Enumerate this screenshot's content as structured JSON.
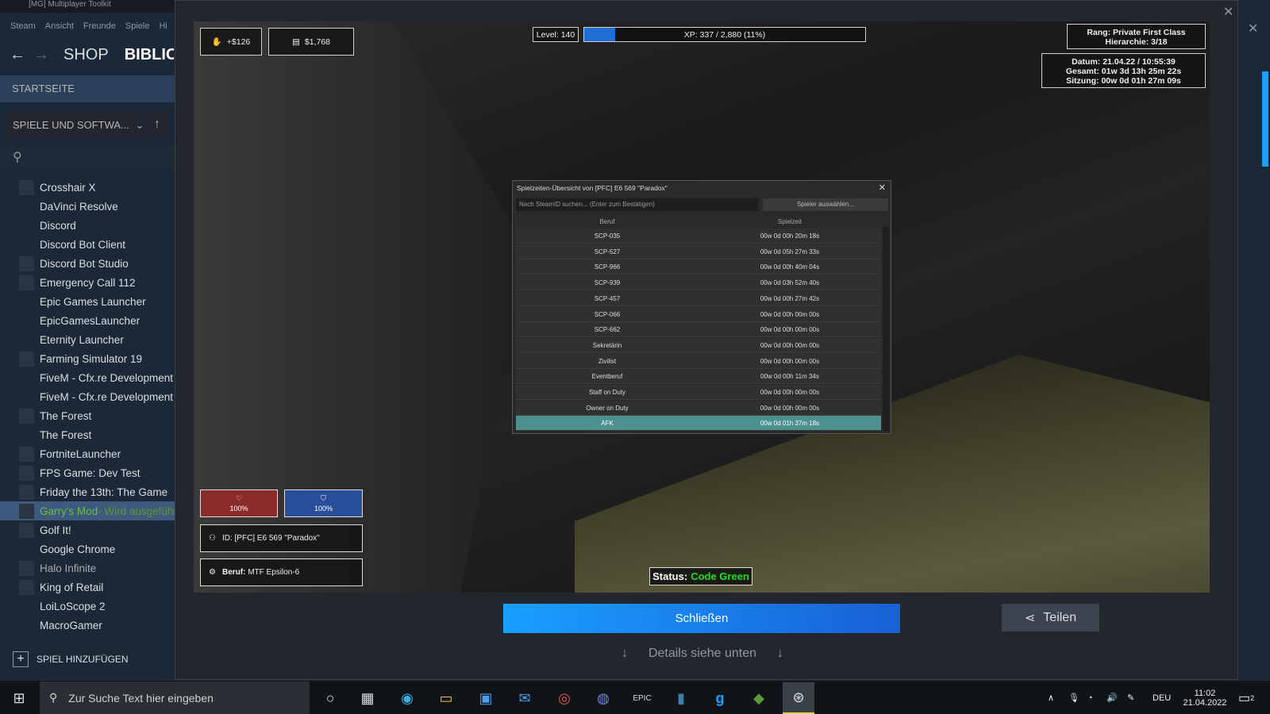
{
  "steam": {
    "window_title": "[MG] Multiplayer Toolkit",
    "menu": [
      "Steam",
      "Ansicht",
      "Freunde",
      "Spiele",
      "Hilfe"
    ],
    "nav": {
      "shop": "SHOP",
      "library": "BIBLIOTHEK"
    },
    "home": "STARTSEITE",
    "filter": "SPIELE UND SOFTWA...",
    "add_game": "SPIEL HINZUFÜGEN",
    "games": [
      {
        "name": "Crosshair X",
        "icon": "crosshair-icon"
      },
      {
        "name": "DaVinci Resolve",
        "icon": "blank-icon"
      },
      {
        "name": "Discord",
        "icon": "blank-icon"
      },
      {
        "name": "Discord Bot Client",
        "icon": "blank-icon"
      },
      {
        "name": "Discord Bot Studio",
        "icon": "gear-icon"
      },
      {
        "name": "Emergency Call 112",
        "icon": "game-icon"
      },
      {
        "name": "Epic Games Launcher",
        "icon": "blank-icon"
      },
      {
        "name": "EpicGamesLauncher",
        "icon": "blank-icon"
      },
      {
        "name": "Eternity Launcher",
        "icon": "blank-icon"
      },
      {
        "name": "Farming Simulator 19",
        "icon": "game-icon"
      },
      {
        "name": "FiveM - Cfx.re Development",
        "icon": "blank-icon"
      },
      {
        "name": "FiveM - Cfx.re Development",
        "icon": "blank-icon"
      },
      {
        "name": "The Forest",
        "icon": "game-icon"
      },
      {
        "name": "The Forest",
        "icon": "blank-icon"
      },
      {
        "name": "FortniteLauncher",
        "icon": "game-icon"
      },
      {
        "name": "FPS Game: Dev Test",
        "icon": "game-icon"
      },
      {
        "name": "Friday the 13th: The Game",
        "icon": "game-icon"
      },
      {
        "name": "Garry's Mod",
        "icon": "game-icon",
        "status": " - Wird ausgeführt"
      },
      {
        "name": "Golf It!",
        "icon": "game-icon"
      },
      {
        "name": "Google Chrome",
        "icon": "blank-icon"
      },
      {
        "name": "Halo Infinite",
        "icon": "game-icon"
      },
      {
        "name": "King of Retail",
        "icon": "game-icon"
      },
      {
        "name": "LoiLoScope 2",
        "icon": "blank-icon"
      },
      {
        "name": "MacroGamer",
        "icon": "blank-icon"
      }
    ]
  },
  "hud": {
    "money_delta": "+$126",
    "money_total": "$1,768",
    "level": "Level: 140",
    "xp": "XP: 337 / 2,880 (11%)",
    "xp_fraction": 0.11,
    "rank": "Rang: Private First Class",
    "hierarchy": "Hierarchie: 3/18",
    "date": "Datum: 21.04.22 / 10:55:39",
    "total": "Gesamt: 01w 3d 13h 25m 22s",
    "session": "Sitzung: 00w 0d 01h 27m 09s",
    "health": "100%",
    "armor": "100%",
    "id": "ID: [PFC] E6 569 \"Paradox\"",
    "job_label": "Beruf:",
    "job": "MTF Epsilon-6",
    "status_label": "Status:",
    "status_value": "Code Green"
  },
  "dialog": {
    "title": "Spielzeiten-Übersicht von [PFC] E6 569 \"Paradox\"",
    "search_placeholder": "Nach SteamID suchen... (Enter zum Bestätigen)",
    "select_button": "Spieler auswählen...",
    "col_job": "Beruf",
    "col_time": "Spielzeit",
    "rows": [
      {
        "job": "SCP-035",
        "time": "00w 0d 00h 20m 18s"
      },
      {
        "job": "SCP-527",
        "time": "00w 0d 05h 27m 33s"
      },
      {
        "job": "SCP-966",
        "time": "00w 0d 00h 40m 04s"
      },
      {
        "job": "SCP-939",
        "time": "00w 0d 03h 52m 40s"
      },
      {
        "job": "SCP-457",
        "time": "00w 0d 00h 27m 42s"
      },
      {
        "job": "SCP-066",
        "time": "00w 0d 00h 00m 00s"
      },
      {
        "job": "SCP-662",
        "time": "00w 0d 00h 00m 00s"
      },
      {
        "job": "Sekretärin",
        "time": "00w 0d 00h 00m 00s"
      },
      {
        "job": "Zivilist",
        "time": "00w 0d 00h 00m 00s"
      },
      {
        "job": "Eventberuf",
        "time": "00w 0d 00h 11m 34s"
      },
      {
        "job": "Staff on Duty",
        "time": "00w 0d 00h 00m 00s"
      },
      {
        "job": "Owner on Duty",
        "time": "00w 0d 00h 00m 00s"
      },
      {
        "job": "AFK",
        "time": "00w 0d 01h 37m 18s"
      }
    ]
  },
  "viewer": {
    "close_button": "Schließen",
    "share_button": "Teilen",
    "details": "Details siehe unten"
  },
  "taskbar": {
    "search_placeholder": "Zur Suche Text hier eingeben",
    "lang": "DEU",
    "time": "11:02",
    "date": "21.04.2022",
    "notifications": "2"
  },
  "colors": {
    "accent": "#1a9fff",
    "status_green": "#1ee01e",
    "highlight_row": "#4c8f8f",
    "health": "#8b2a2a",
    "armor": "#2a4f9a"
  }
}
